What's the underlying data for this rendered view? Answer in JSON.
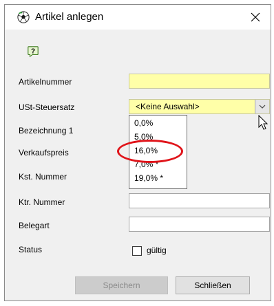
{
  "window": {
    "title": "Artikel anlegen",
    "close_glyph": "✕"
  },
  "icons": {
    "app": "soccer-ball-icon",
    "help": "help-icon",
    "help_glyph": "?"
  },
  "form": {
    "artikelnummer": {
      "label": "Artikelnummer",
      "value": ""
    },
    "ust": {
      "label": "USt-Steuersatz",
      "value": "<Keine Auswahl>"
    },
    "bezeichnung": {
      "label": "Bezeichnung 1"
    },
    "verkaufspreis": {
      "label": "Verkaufspreis"
    },
    "kst": {
      "label": "Kst. Nummer"
    },
    "ktr": {
      "label": "Ktr. Nummer",
      "value": ""
    },
    "belegart": {
      "label": "Belegart",
      "value": ""
    },
    "status": {
      "label": "Status",
      "checkbox_label": "gültig",
      "checked": false
    }
  },
  "dropdown": {
    "options": [
      "0,0%",
      "5,0%",
      "16,0%",
      "7,0% *",
      "19,0% *"
    ],
    "highlighted_option": "16,0%"
  },
  "buttons": {
    "save": "Speichern",
    "close": "Schließen",
    "save_enabled": false
  },
  "colors": {
    "required_field": "#ffffa8",
    "highlight": "#e0141a"
  }
}
